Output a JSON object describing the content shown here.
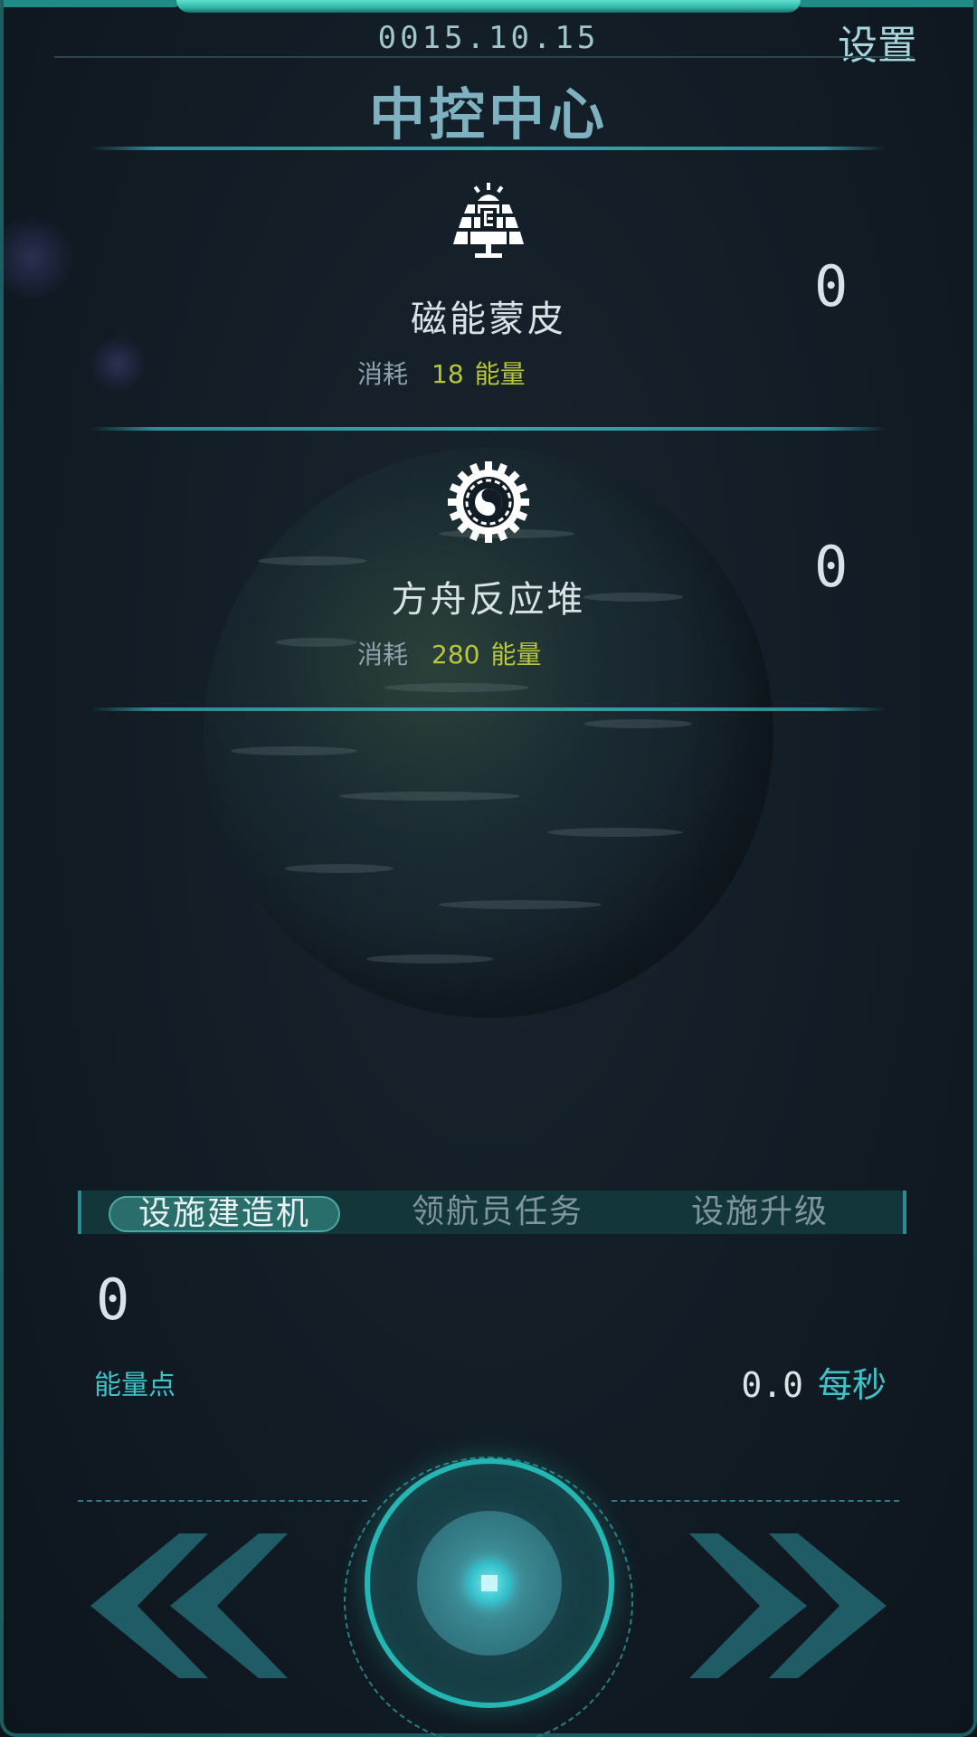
{
  "header": {
    "date": "0015.10.15",
    "settings_label": "设置",
    "title": "中控中心"
  },
  "facilities": [
    {
      "icon": "solar-panel-icon",
      "name": "磁能蒙皮",
      "cost_label": "消耗",
      "cost_value": "18",
      "cost_unit": "能量",
      "count": "0"
    },
    {
      "icon": "gear-reactor-icon",
      "name": "方舟反应堆",
      "cost_label": "消耗",
      "cost_value": "280",
      "cost_unit": "能量",
      "count": "0"
    }
  ],
  "tabs": [
    {
      "label": "设施建造机",
      "active": true
    },
    {
      "label": "领航员任务",
      "active": false
    },
    {
      "label": "设施升级",
      "active": false
    }
  ],
  "energy": {
    "value": "0",
    "label": "能量点",
    "rate_value": "0.0",
    "rate_unit": "每秒"
  },
  "colors": {
    "accent": "#23b6b3",
    "cost_yellow": "#b8c83a",
    "label_cyan": "#3fc3c9",
    "background": "#121c25"
  },
  "controls": {
    "left_icon": "double-chevron-left-icon",
    "right_icon": "double-chevron-right-icon",
    "center_icon": "stop-button-icon"
  }
}
